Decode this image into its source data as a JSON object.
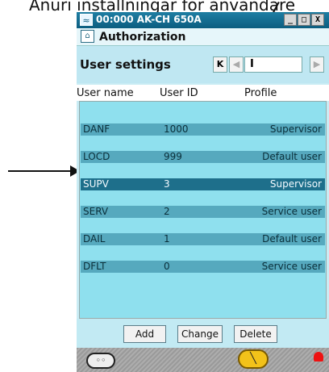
{
  "caption": {
    "text": "Anuri installningar for anvandare"
  },
  "window": {
    "title": "00:000 AK-CH 650A",
    "controls": {
      "minimize": "_",
      "maximize": "□",
      "close": "X"
    }
  },
  "header": {
    "title": "Authorization"
  },
  "settings": {
    "title": "User settings",
    "nav": {
      "first": "K",
      "prev": "◀",
      "value": "I",
      "next": "▶"
    }
  },
  "table": {
    "columns": [
      "User name",
      "User ID",
      "Profile"
    ],
    "rows": [
      {
        "name": "DANF",
        "id": "1000",
        "profile": "Supervisor"
      },
      {
        "name": "LOCD",
        "id": "999",
        "profile": "Default user"
      },
      {
        "name": "SUPV",
        "id": "3",
        "profile": "Supervisor",
        "selected": true
      },
      {
        "name": "SERV",
        "id": "2",
        "profile": "Service user"
      },
      {
        "name": "DAIL",
        "id": "1",
        "profile": "Default user"
      },
      {
        "name": "DFLT",
        "id": "0",
        "profile": "Service user"
      }
    ]
  },
  "buttons": {
    "add": "Add",
    "change": "Change",
    "delete": "Delete"
  },
  "colors": {
    "titlebar": "#0c5d80",
    "row": "#56a9be",
    "selected_row": "#1e6f8b",
    "list_bg": "#8fe0ee",
    "alarm": "#e11111"
  },
  "icons": [
    "window-app-icon",
    "home-icon",
    "gamepad-icon",
    "wrench-icon",
    "alarm-bell-icon"
  ]
}
